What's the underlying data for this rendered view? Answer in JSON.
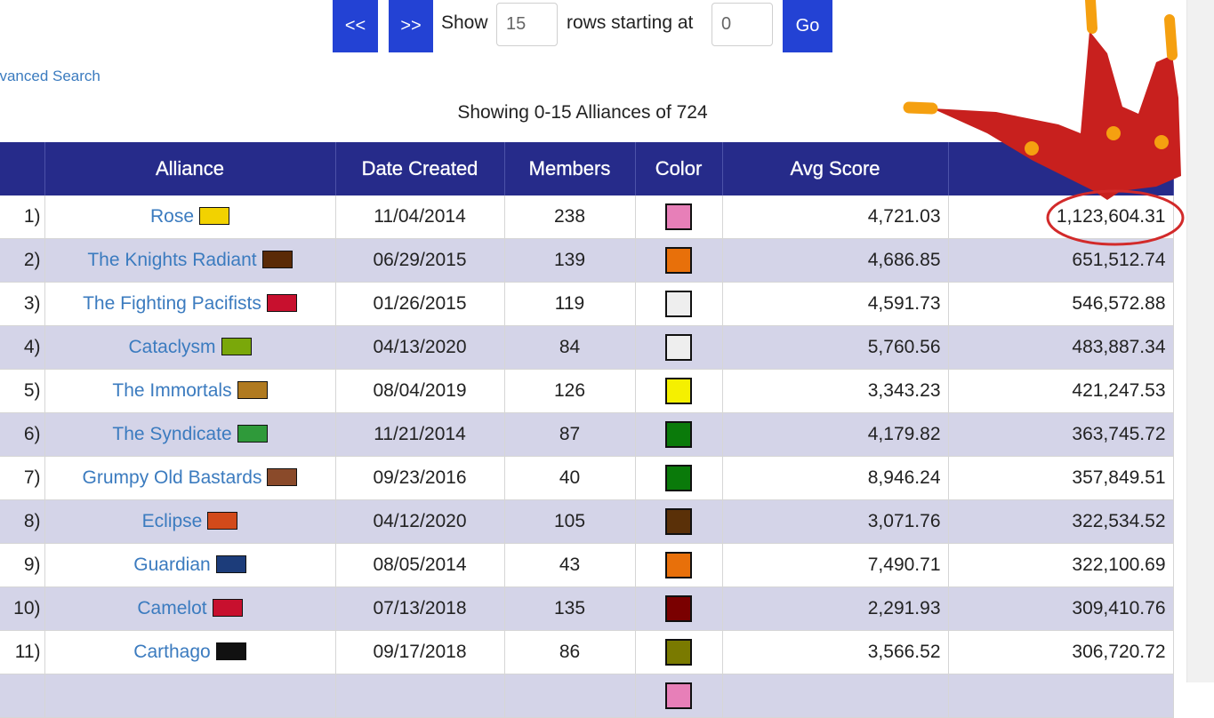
{
  "pager": {
    "prev_label": "<<",
    "next_label": ">>",
    "show_label": "Show",
    "rows_value": "15",
    "starting_label": "rows starting at",
    "start_value": "0",
    "go_label": "Go"
  },
  "advanced_search_label": "dvanced Search",
  "summary": "Showing 0-15 Alliances of 724",
  "table": {
    "headers": [
      "",
      "Alliance",
      "Date Created",
      "Members",
      "Color",
      "Avg Score",
      ""
    ],
    "rows": [
      {
        "rank": "1)",
        "name": "Rose",
        "date": "11/04/2014",
        "members": "238",
        "color": "#e77fb8",
        "avg": "4,721.03",
        "score": "1,123,604.31",
        "flag_icon": "rose-flag-icon",
        "flag_color": "#f2d200"
      },
      {
        "rank": "2)",
        "name": "The Knights Radiant",
        "date": "06/29/2015",
        "members": "139",
        "color": "#e8700a",
        "avg": "4,686.85",
        "score": "651,512.74",
        "flag_icon": "knights-radiant-flag-icon",
        "flag_color": "#5a2a06"
      },
      {
        "rank": "3)",
        "name": "The Fighting Pacifists",
        "date": "01/26/2015",
        "members": "119",
        "color": "#eeeeee",
        "avg": "4,591.73",
        "score": "546,572.88",
        "flag_icon": "fighting-pacifists-flag-icon",
        "flag_color": "#c8102e"
      },
      {
        "rank": "4)",
        "name": "Cataclysm",
        "date": "04/13/2020",
        "members": "84",
        "color": "#eeeeee",
        "avg": "5,760.56",
        "score": "483,887.34",
        "flag_icon": "cataclysm-flag-icon",
        "flag_color": "#7aa80a"
      },
      {
        "rank": "5)",
        "name": "The Immortals",
        "date": "08/04/2019",
        "members": "126",
        "color": "#f5f000",
        "avg": "3,343.23",
        "score": "421,247.53",
        "flag_icon": "immortals-flag-icon",
        "flag_color": "#b07a20"
      },
      {
        "rank": "6)",
        "name": "The Syndicate",
        "date": "11/21/2014",
        "members": "87",
        "color": "#0a7a0a",
        "avg": "4,179.82",
        "score": "363,745.72",
        "flag_icon": "syndicate-flag-icon",
        "flag_color": "#2f9a3a"
      },
      {
        "rank": "7)",
        "name": "Grumpy Old Bastards",
        "date": "09/23/2016",
        "members": "40",
        "color": "#0a7a0a",
        "avg": "8,946.24",
        "score": "357,849.51",
        "flag_icon": "grumpy-old-bastards-flag-icon",
        "flag_color": "#8a4a2a"
      },
      {
        "rank": "8)",
        "name": "Eclipse",
        "date": "04/12/2020",
        "members": "105",
        "color": "#5a3008",
        "avg": "3,071.76",
        "score": "322,534.52",
        "flag_icon": "eclipse-flag-icon",
        "flag_color": "#d24a1a"
      },
      {
        "rank": "9)",
        "name": "Guardian",
        "date": "08/05/2014",
        "members": "43",
        "color": "#e8700a",
        "avg": "7,490.71",
        "score": "322,100.69",
        "flag_icon": "guardian-flag-icon",
        "flag_color": "#1c3c7a"
      },
      {
        "rank": "10)",
        "name": "Camelot",
        "date": "07/13/2018",
        "members": "135",
        "color": "#7a0000",
        "avg": "2,291.93",
        "score": "309,410.76",
        "flag_icon": "camelot-flag-icon",
        "flag_color": "#c8102e"
      },
      {
        "rank": "11)",
        "name": "Carthago",
        "date": "09/17/2018",
        "members": "86",
        "color": "#7a7a00",
        "avg": "3,566.52",
        "score": "306,720.72",
        "flag_icon": "carthago-flag-icon",
        "flag_color": "#111111"
      },
      {
        "rank": "",
        "name": "",
        "date": "",
        "members": "",
        "color": "#e77fb8",
        "avg": "",
        "score": "",
        "flag_icon": "",
        "flag_color": ""
      }
    ]
  },
  "annotation": {
    "crown_color": "#c8201e",
    "accent_color": "#f5a010",
    "circle_color": "#d22a2a"
  }
}
